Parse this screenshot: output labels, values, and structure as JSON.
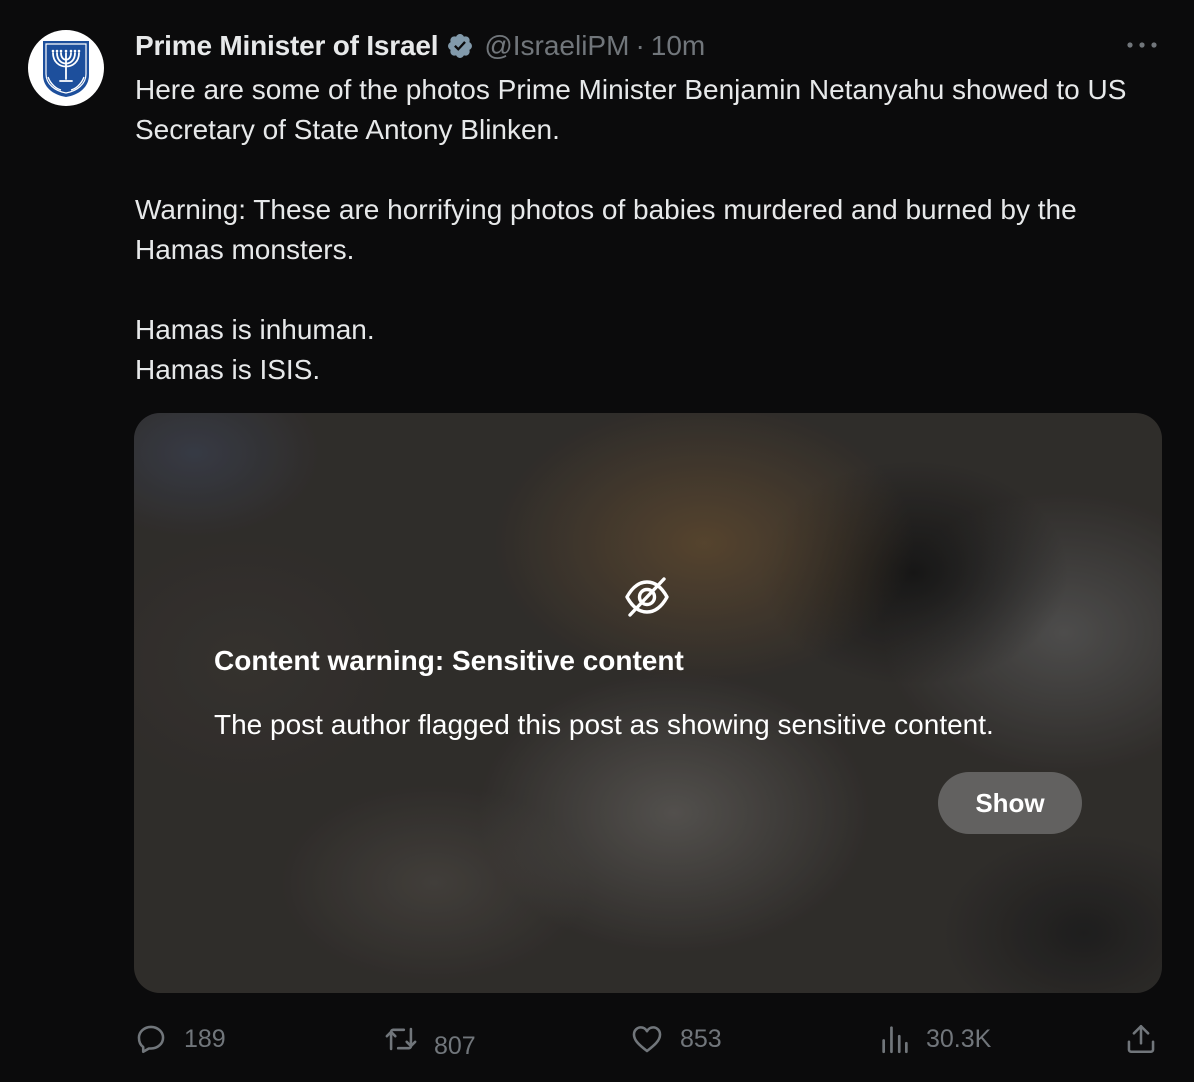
{
  "author": {
    "display_name": "Prime Minister of Israel",
    "handle": "@IsraeliPM",
    "separator": "·",
    "time": "10m",
    "avatar_icon": "menorah-emblem-icon",
    "verified_icon": "verified-badge-icon",
    "verified_color": "#829aab"
  },
  "more_icon": "more-horizontal-icon",
  "body": {
    "paragraphs": [
      "Here are some of the photos Prime Minister Benjamin Netanyahu showed to US Secretary of State Antony Blinken.",
      "Warning: These are horrifying photos of babies murdered and burned by the Hamas monsters.",
      "Hamas is inhuman.",
      "Hamas is ISIS."
    ]
  },
  "media": {
    "warning_icon": "eye-slash-icon",
    "warning_title": "Content warning: Sensitive content",
    "warning_text": "The post author flagged this post as showing sensitive content.",
    "show_label": "Show"
  },
  "actions": {
    "replies": "189",
    "reposts": "807",
    "likes": "853",
    "views": "30.3K",
    "icons": [
      "reply-icon",
      "repost-icon",
      "like-icon",
      "views-icon",
      "share-icon"
    ]
  },
  "colors": {
    "background": "#0b0b0c",
    "primary_text": "#e7e9ea",
    "secondary_text": "#71767b",
    "avatar_blue": "#1d4f9c"
  }
}
